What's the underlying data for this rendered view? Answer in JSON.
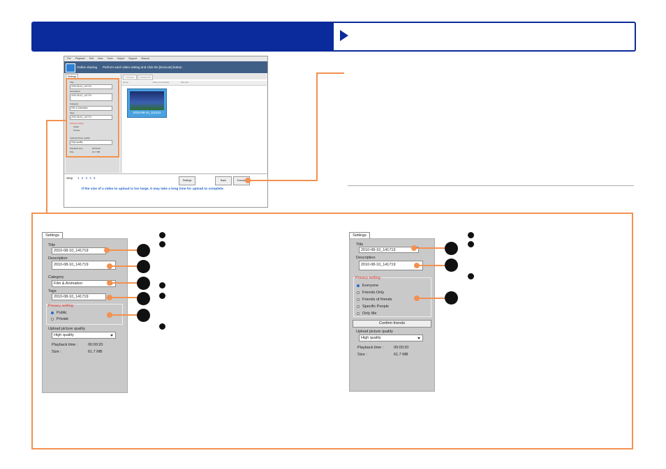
{
  "app": {
    "menu": [
      "File",
      "Playback",
      "Edit",
      "View",
      "Tools",
      "Output",
      "Support",
      "Manual"
    ],
    "title": "Online sharing",
    "instruction": "Perform each video setting and click the [Execute] button.",
    "settings_tab": "Settings",
    "right_tabs": [
      "Contents",
      "Detailed list"
    ],
    "columns": [
      "Name",
      "Date of recording",
      "File size"
    ],
    "thumbnail_caption": "2010-08-10_111522",
    "fields": {
      "title_label": "Title",
      "title_value": "2010-08-10_141719",
      "description_label": "Description",
      "description_value": "2010-08-10_141719",
      "category_label": "Category",
      "category_value": "Film & Animation",
      "tags_label": "Tags",
      "tags_value": "2010-08-10_141719",
      "privacy_label": "Privacy setting",
      "privacy_public": "Public",
      "privacy_private": "Private",
      "quality_label": "Upload picture quality",
      "quality_value": "High quality",
      "playback_label": "Playback time",
      "playback_value": "00:00:20",
      "size_label": "Size",
      "size_value": "61.7 MB"
    },
    "step_label": "Step",
    "steps": "1 2 3 4 5",
    "buttons": {
      "settings": "Settings",
      "back": "Back",
      "execute": "Execute"
    },
    "warning": "If the size of a video to upload is too large, it may take a long time for upload to complete."
  },
  "panel_left": {
    "tab": "Settings",
    "title_label": "Title",
    "title_value": "2010-08-10_141719",
    "description_label": "Description",
    "description_value": "2010-08-10_141719",
    "category_label": "Category",
    "category_value": "Film & Animation",
    "tags_label": "Tags",
    "tags_value": "2010-08-10_141719",
    "privacy_label": "Privacy setting",
    "privacy_options": [
      "Public",
      "Private"
    ],
    "quality_label": "Upload picture quality",
    "quality_value": "High quality",
    "playback_label": "Playback time :",
    "playback_value": "00:00:20",
    "size_label": "Size :",
    "size_value": "61.7 MB"
  },
  "panel_right": {
    "tab": "Settings",
    "title_label": "Title",
    "title_value": "2010-08-10_141719",
    "description_label": "Description",
    "description_value": "2010-08-10_141719",
    "privacy_label": "Privacy setting",
    "privacy_options": [
      "Everyone",
      "Friends Only",
      "Friends of friends",
      "Specific People",
      "Only Me"
    ],
    "confirm_button": "Confirm friends",
    "quality_label": "Upload picture quality",
    "quality_value": "High quality",
    "playback_label": "Playback time :",
    "playback_value": "00:00:20",
    "size_label": "Size :",
    "size_value": "61.7 MB"
  },
  "colors": {
    "header_blue": "#0b2a9c",
    "accent_orange": "#f39150",
    "privacy_red": "#e0322b"
  }
}
